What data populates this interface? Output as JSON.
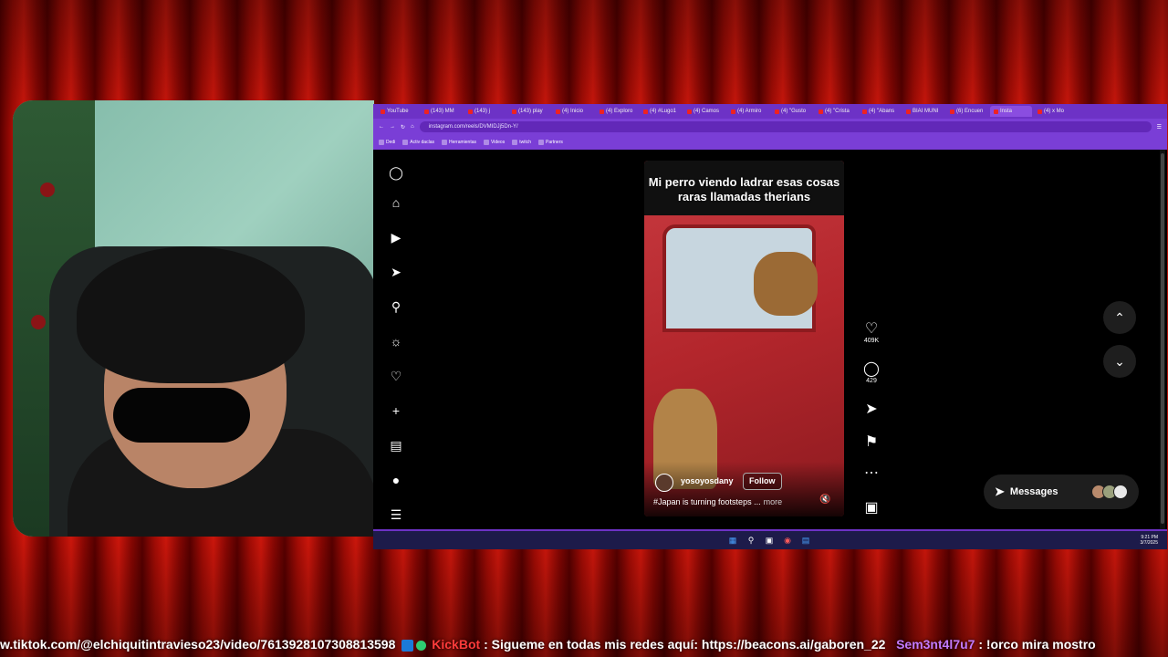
{
  "browser": {
    "tabs": [
      {
        "label": "YouTube"
      },
      {
        "label": "(143) MM"
      },
      {
        "label": "(143) j"
      },
      {
        "label": "(143) play"
      },
      {
        "label": "(4) Inicio"
      },
      {
        "label": "(4) Exploro"
      },
      {
        "label": "(4) #Lugo1"
      },
      {
        "label": "(4) Camos"
      },
      {
        "label": "(4) Armiro"
      },
      {
        "label": "(4) \"Gusto"
      },
      {
        "label": "(4) \"Crista"
      },
      {
        "label": "(4) \"Abans"
      },
      {
        "label": "BIAI MUNI"
      },
      {
        "label": "(6) Encuen"
      },
      {
        "label": "Insta"
      },
      {
        "label": "(4) x Mo"
      }
    ],
    "active_tab": "Insta",
    "url": "instagram.com/reels/DVMIDJj5Dn-Y/",
    "bookmarks": [
      "Dedi",
      "Activ daclas",
      "Herramientas",
      "Videos",
      "twitch",
      "Partners"
    ]
  },
  "instagram": {
    "reel_overlay_text": "Mi perro viendo ladrar esas cosas raras llamadas therians",
    "username": "yosoyosdany",
    "follow_label": "Follow",
    "description": "#⁠Japan is turning footsteps ...",
    "more_label": "more",
    "likes": "409K",
    "comments": "429",
    "messages_label": "Messages"
  },
  "taskbar": {
    "time": "9:21 PM",
    "date": "3/7/2025"
  },
  "ticker": {
    "link": "w.tiktok.com/@elchiquitintravieso23/video/7613928107308813598",
    "bot_name": "KickBot",
    "bot_message": ": Sigueme en todas mis redes aquí: https://beacons.ai/gaboren_22",
    "user_name": "Sem3nt4l7u7",
    "user_message": ": !orco mira mostro"
  },
  "colors": {
    "browser_accent": "#7a3ed6",
    "bot_color": "#ff3b3b",
    "user_color": "#c37aff"
  }
}
